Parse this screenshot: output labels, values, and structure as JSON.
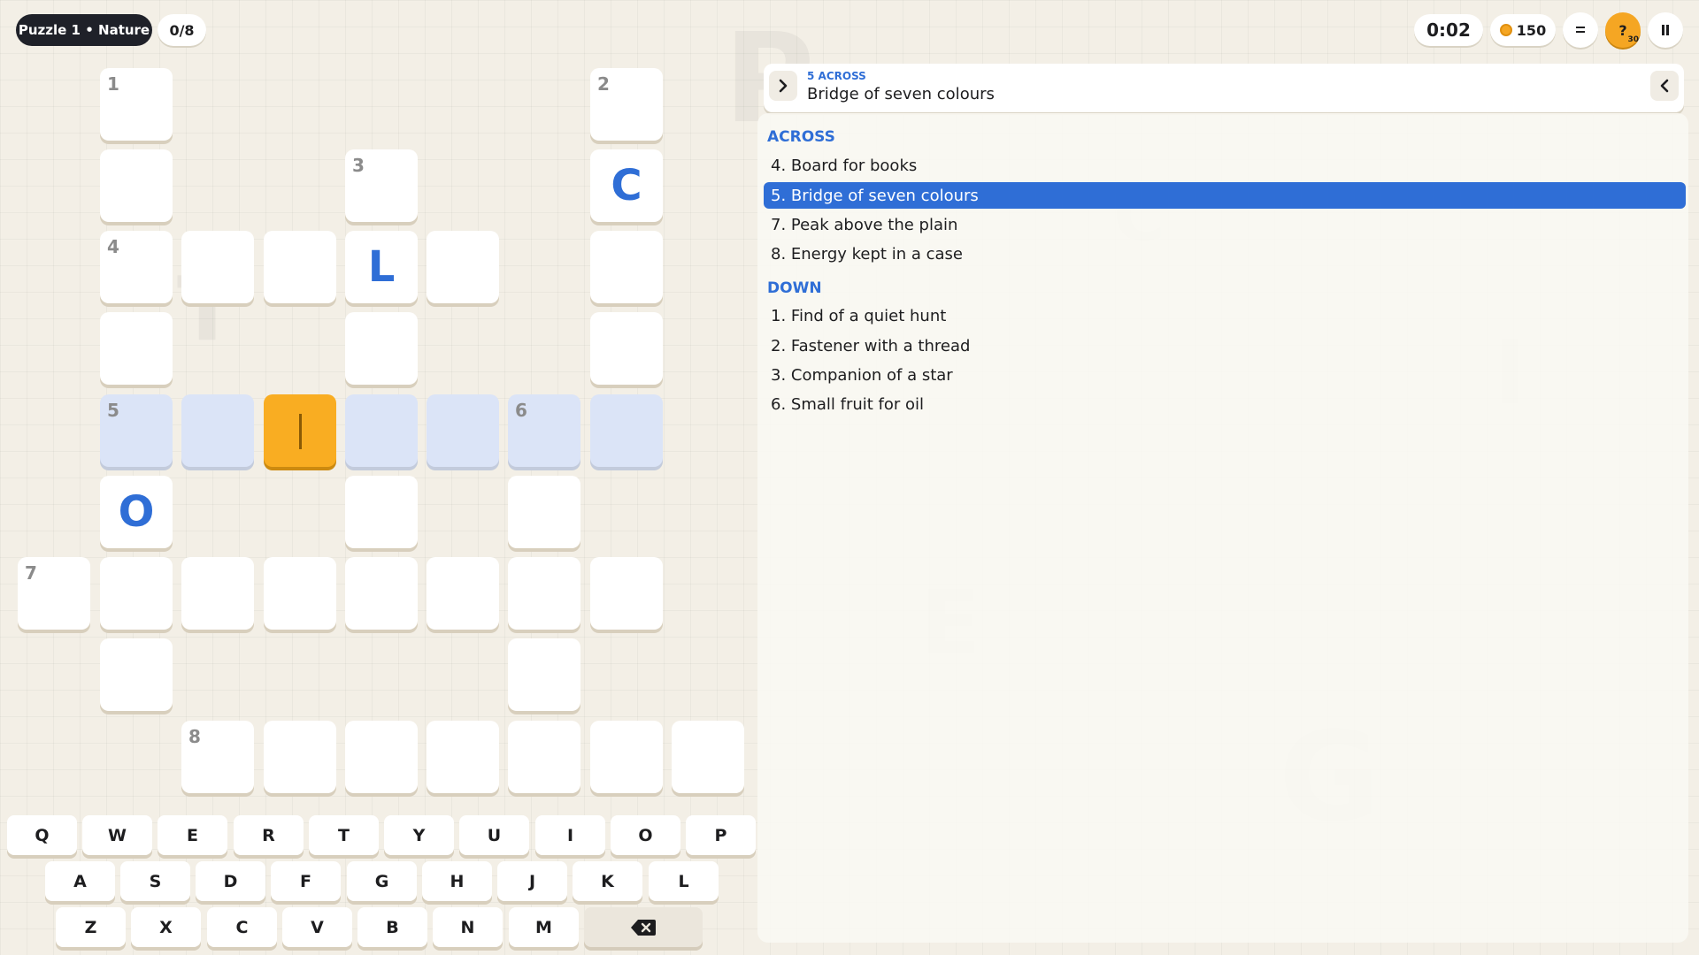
{
  "header": {
    "puzzle_title": "Puzzle 1 • Nature",
    "progress": "0/8"
  },
  "status": {
    "timer": "0:02",
    "coins": "150",
    "hints_left": "30"
  },
  "icons": {
    "menu": "menu-icon",
    "hint": "hint-icon",
    "pause": "pause-icon",
    "coin": "coin-icon",
    "prev": "chevron-left-icon",
    "next": "chevron-right-icon",
    "backspace": "backspace-icon"
  },
  "colors": {
    "accent_blue": "#2f6ed6",
    "active_orange": "#f9ad22",
    "word_highlight": "#dbe4f7"
  },
  "grid": {
    "numbers": {
      "n1": "1",
      "n2": "2",
      "n3": "3",
      "n4": "4",
      "n5": "5",
      "n6": "6",
      "n7": "7",
      "n8": "8"
    },
    "letters": {
      "c": "C",
      "l": "L",
      "o": "O"
    }
  },
  "current_clue": {
    "label": "5 ACROSS",
    "text": "Bridge of seven colours"
  },
  "clues": {
    "across_title": "ACROSS",
    "across": [
      "4. Board for books",
      "5. Bridge of seven colours",
      "7. Peak above the plain",
      "8. Energy kept in a case"
    ],
    "down_title": "DOWN",
    "down": [
      "1. Find of a quiet hunt",
      "2. Fastener with a thread",
      "3. Companion of a star",
      "6. Small fruit for oil"
    ]
  },
  "keyboard": {
    "row1": [
      "Q",
      "W",
      "E",
      "R",
      "T",
      "Y",
      "U",
      "I",
      "O",
      "P"
    ],
    "row2": [
      "A",
      "S",
      "D",
      "F",
      "G",
      "H",
      "J",
      "K",
      "L"
    ],
    "row3": [
      "Z",
      "X",
      "C",
      "V",
      "B",
      "N",
      "M"
    ]
  },
  "decor_letters": {
    "g1": "P",
    "g2": "C",
    "g3": "I",
    "g4": "E",
    "g5": "G",
    "g6": "T"
  }
}
